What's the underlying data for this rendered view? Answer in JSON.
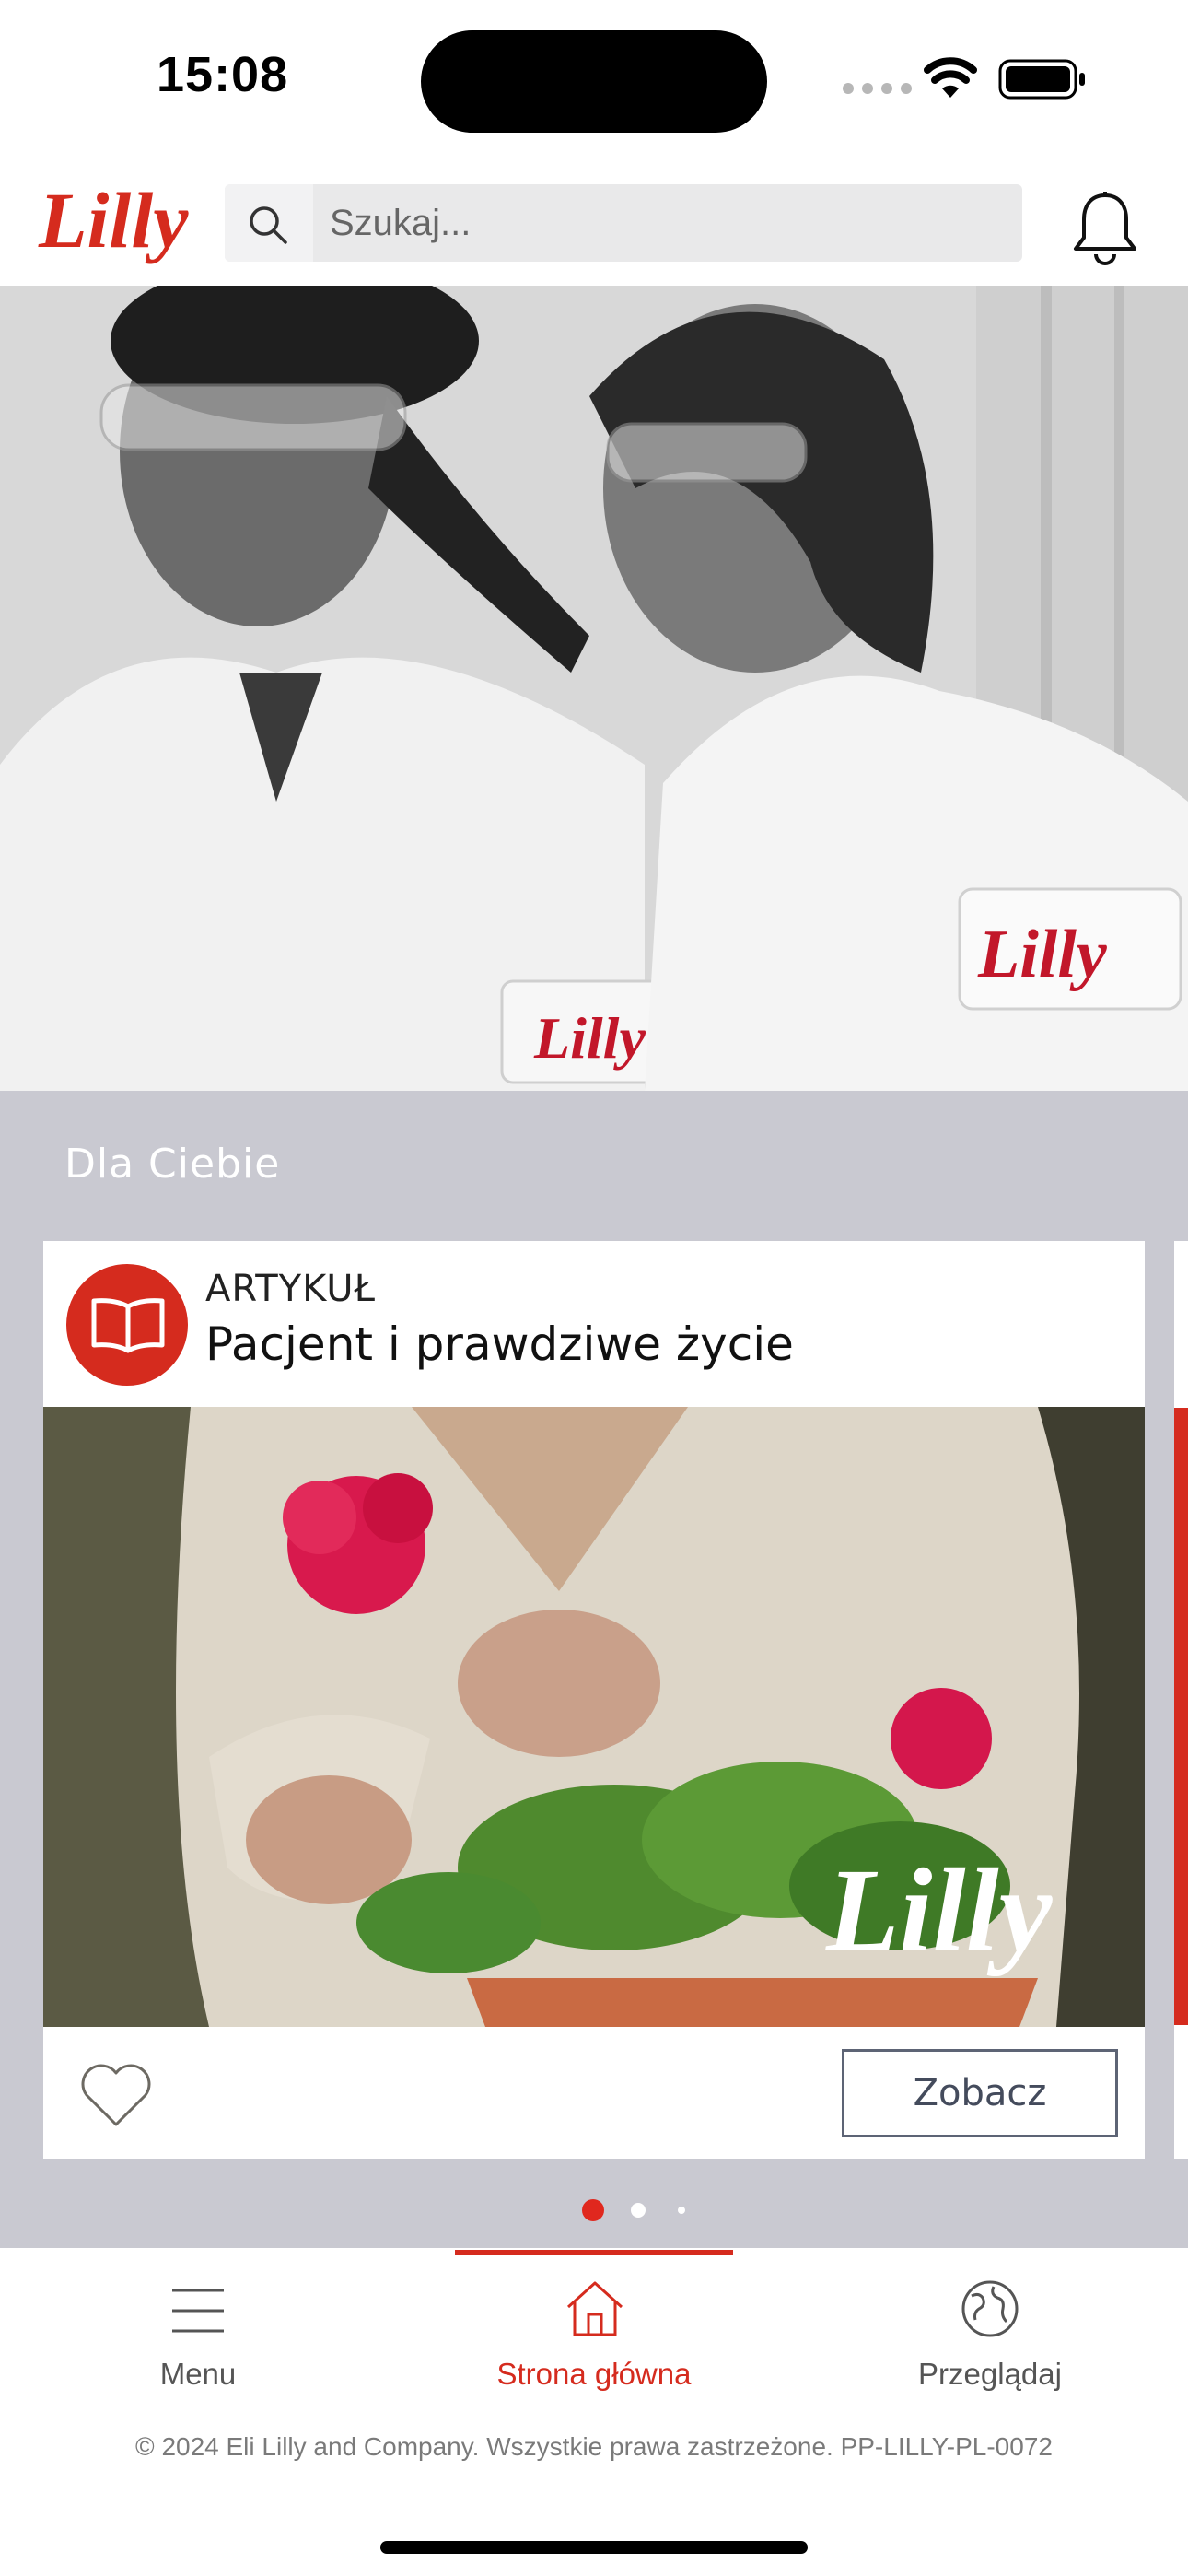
{
  "status_bar": {
    "time": "15:08"
  },
  "header": {
    "logo_text": "Lilly",
    "search_placeholder": "Szukaj...",
    "brand_color": "#d52b1e"
  },
  "hero": {
    "badge_text": "Lilly"
  },
  "section": {
    "title": "Dla Ciebie",
    "card": {
      "type_label": "ARTYKUŁ",
      "title": "Pacjent i prawdziwe życie",
      "image_logo": "Lilly",
      "view_button": "Zobacz",
      "icons": {
        "badge": "book-icon",
        "favorite": "heart-icon"
      }
    },
    "carousel": {
      "active_index": 0,
      "count": 3
    }
  },
  "tabbar": {
    "items": [
      {
        "label": "Menu",
        "icon": "menu-icon",
        "active": false
      },
      {
        "label": "Strona główna",
        "icon": "home-icon",
        "active": true
      },
      {
        "label": "Przeglądaj",
        "icon": "globe-icon",
        "active": false
      }
    ],
    "active_color": "#d52b1e",
    "inactive_color": "#555555"
  },
  "footer": {
    "copyright": "© 2024 Eli Lilly and Company. Wszystkie prawa zastrzeżone. PP-LILLY-PL-0072"
  }
}
